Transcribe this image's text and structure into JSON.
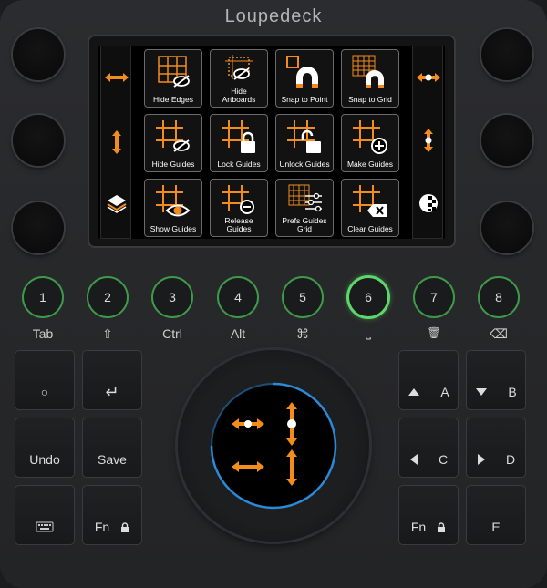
{
  "brand": "Loupedeck",
  "colors": {
    "accent": "#f28c1c",
    "ring": "#3e9a4a",
    "ring_active": "#5dd66a",
    "dial_ring": "#2a8ad8"
  },
  "screen": {
    "left_strip": [
      "left-right-arrows-icon",
      "up-down-arrows-icon",
      "layers-icon"
    ],
    "right_strip": [
      "left-right-dot-arrows-icon",
      "up-down-dot-arrows-icon",
      "checker-circle-icon"
    ],
    "tiles": [
      {
        "label": "Hide Edges"
      },
      {
        "label": "Hide Artboards"
      },
      {
        "label": "Snap to Point"
      },
      {
        "label": "Snap to Grid"
      },
      {
        "label": "Hide Guides"
      },
      {
        "label": "Lock Guides"
      },
      {
        "label": "Unlock Guides"
      },
      {
        "label": "Make Guides"
      },
      {
        "label": "Show Guides"
      },
      {
        "label": "Release Guides"
      },
      {
        "label": "Prefs Guides Grid"
      },
      {
        "label": "Clear Guides"
      }
    ]
  },
  "number_buttons": [
    {
      "num": "1",
      "label": "Tab"
    },
    {
      "num": "2",
      "label": "⇧"
    },
    {
      "num": "3",
      "label": "Ctrl"
    },
    {
      "num": "4",
      "label": "Alt"
    },
    {
      "num": "5",
      "label": "⌘"
    },
    {
      "num": "6",
      "label": "⎵",
      "active": true
    },
    {
      "num": "7",
      "label": "🗑"
    },
    {
      "num": "8",
      "label": "⌫"
    }
  ],
  "left_keys": {
    "circle": "○",
    "enter": "↵",
    "undo": "Undo",
    "save": "Save",
    "keyboard": "keyboard-icon",
    "fn": "Fn"
  },
  "right_keys": {
    "a": "A",
    "b": "B",
    "c": "C",
    "d": "D",
    "fn": "Fn",
    "e": "E"
  },
  "dial": {
    "icons": [
      "left-right-dot-arrows-icon",
      "up-down-dot-arrows-icon",
      "left-right-arrows-icon",
      "up-down-arrows-icon"
    ]
  }
}
